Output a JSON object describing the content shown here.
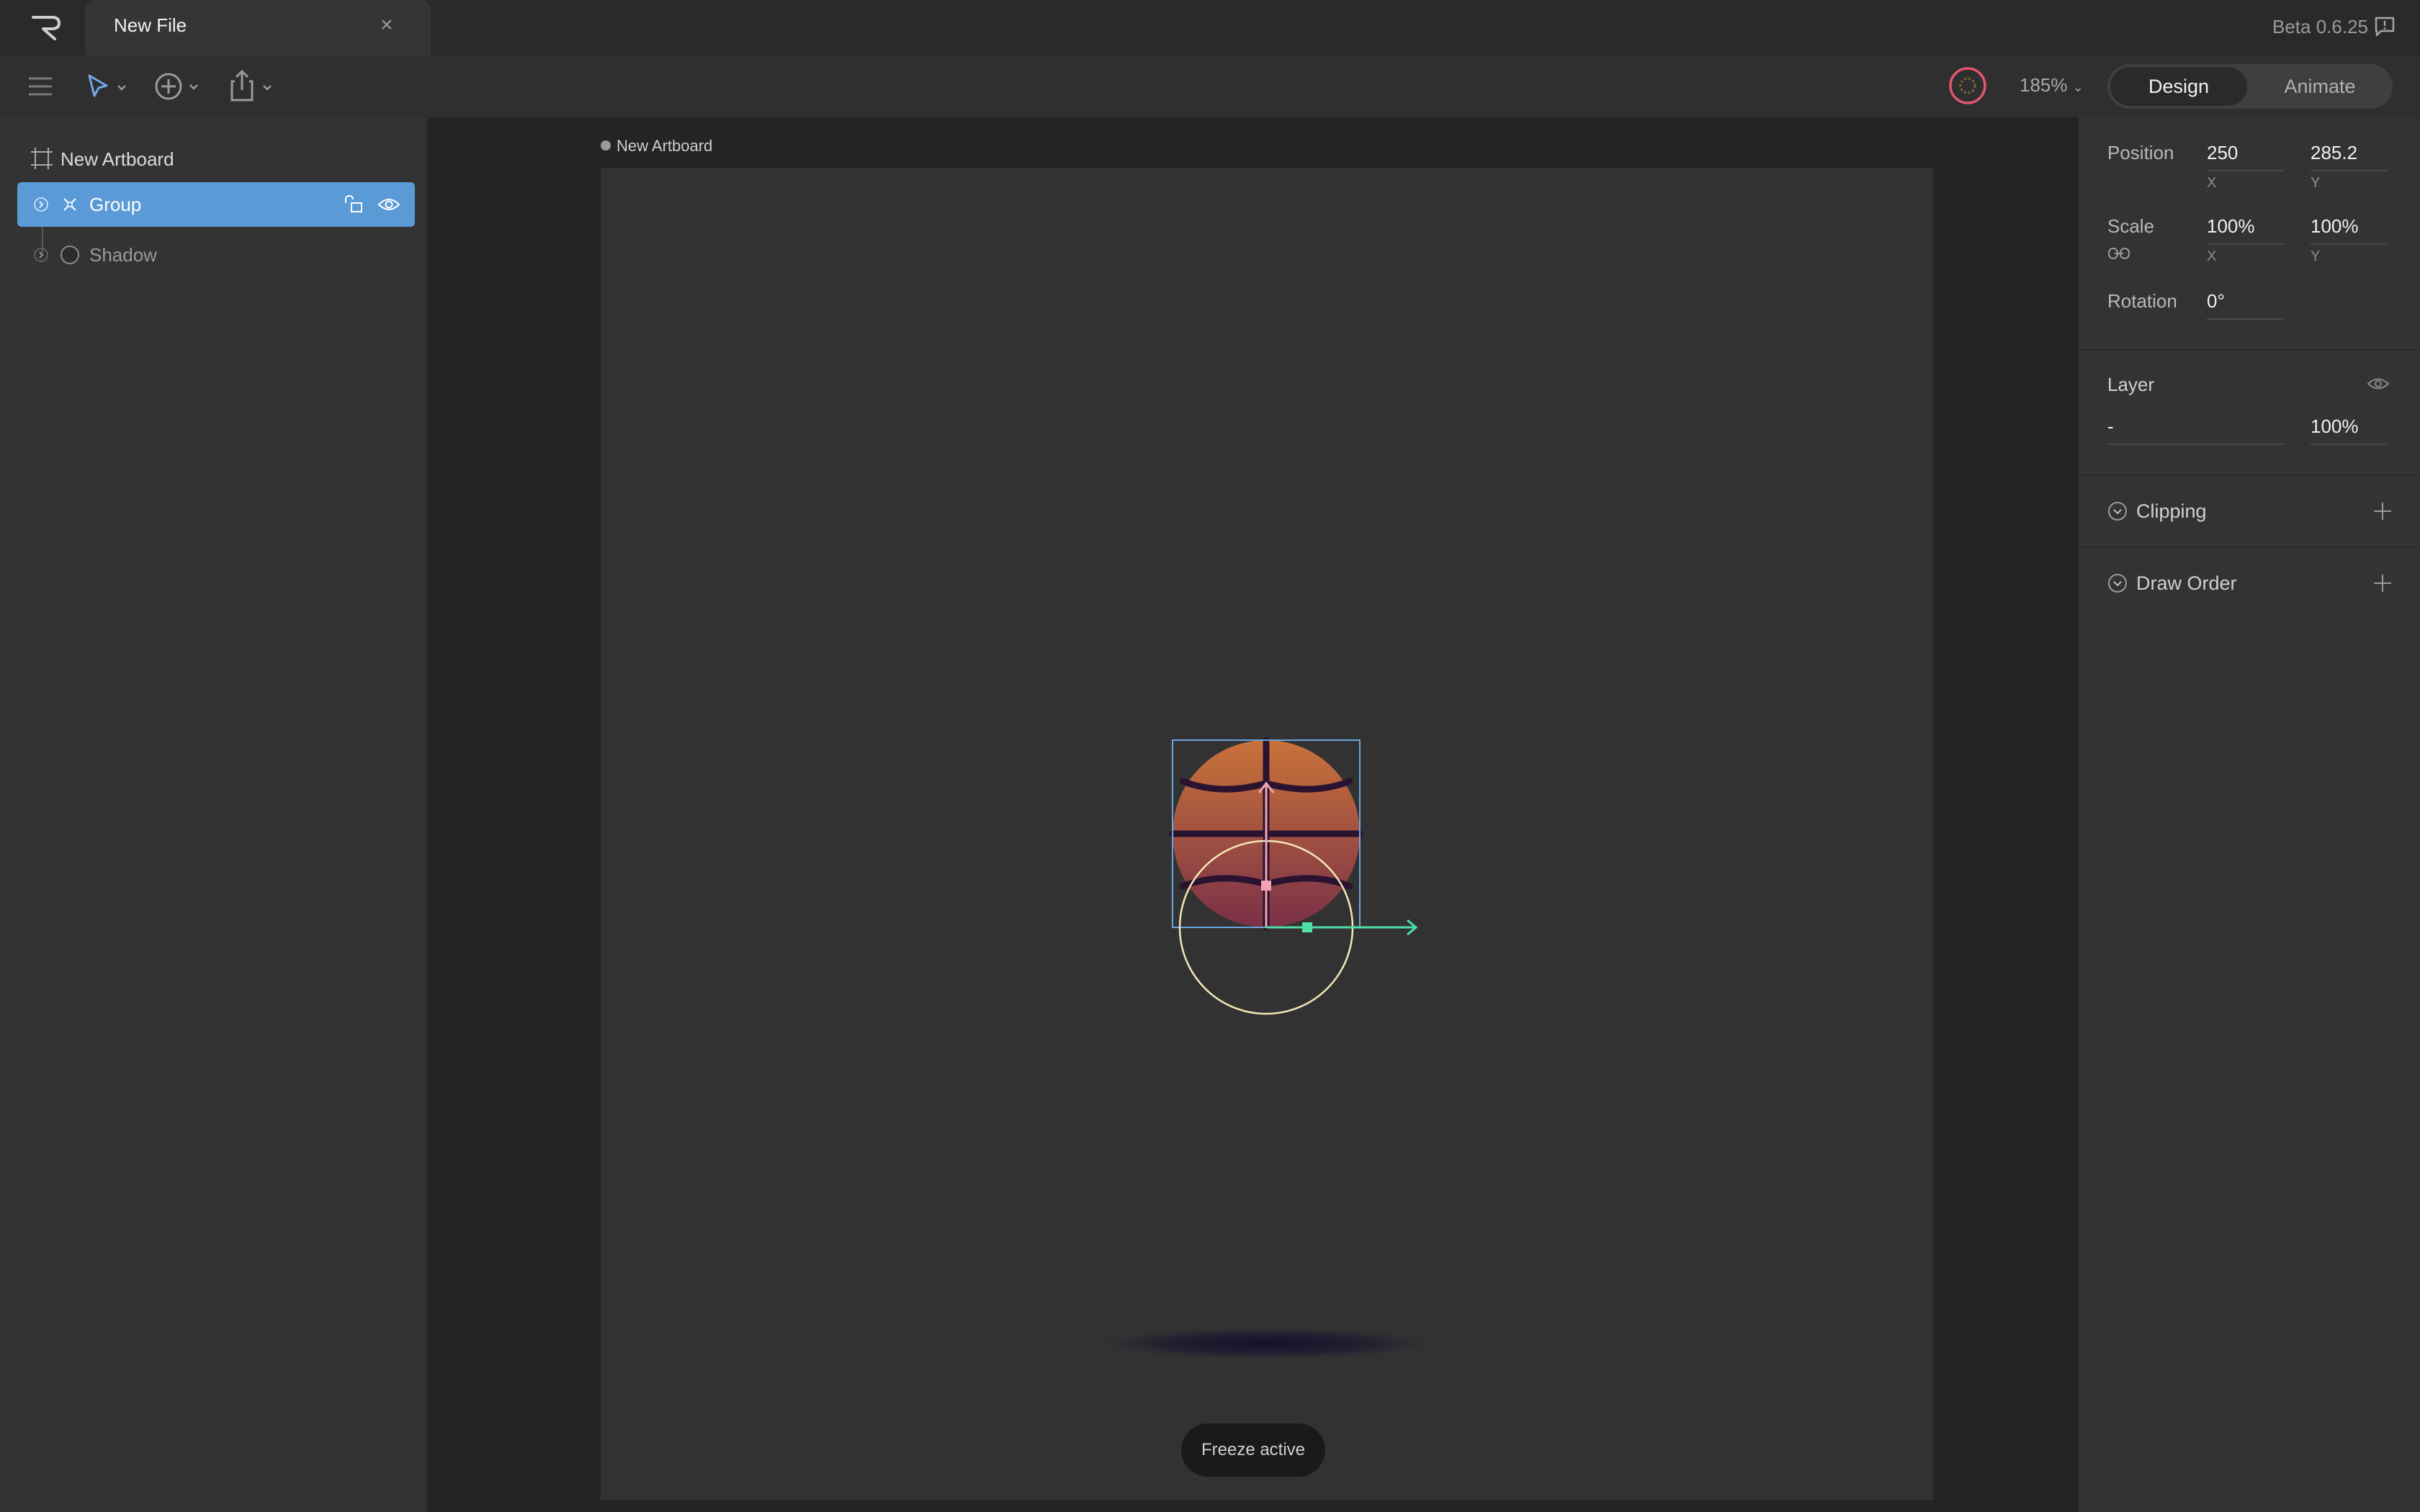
{
  "app": {
    "version": "Beta 0.6.25",
    "tab_title": "New File"
  },
  "toolbar": {
    "zoom": "185%",
    "modes": [
      "Design",
      "Animate"
    ],
    "active_mode": "Design"
  },
  "hierarchy": {
    "artboard": "New Artboard",
    "items": [
      {
        "label": "Group",
        "selected": true
      },
      {
        "label": "Shadow",
        "selected": false
      }
    ]
  },
  "canvas": {
    "artboard_label": "New Artboard",
    "freeze_label": "Freeze active"
  },
  "properties": {
    "position": {
      "label": "Position",
      "x": "250",
      "y": "285.2",
      "x_axis": "X",
      "y_axis": "Y"
    },
    "scale": {
      "label": "Scale",
      "x": "100%",
      "y": "100%",
      "x_axis": "X",
      "y_axis": "Y"
    },
    "rotation": {
      "label": "Rotation",
      "value": "0°"
    },
    "layer": {
      "label": "Layer",
      "blend": "-",
      "opacity": "100%"
    },
    "clipping": {
      "label": "Clipping"
    },
    "draw_order": {
      "label": "Draw Order"
    }
  },
  "colors": {
    "accent_blue": "#5a9ad6",
    "ball_orange": "#c9733a",
    "selection_cream": "#f3e7b5",
    "axis_green": "#4fe0a6"
  }
}
